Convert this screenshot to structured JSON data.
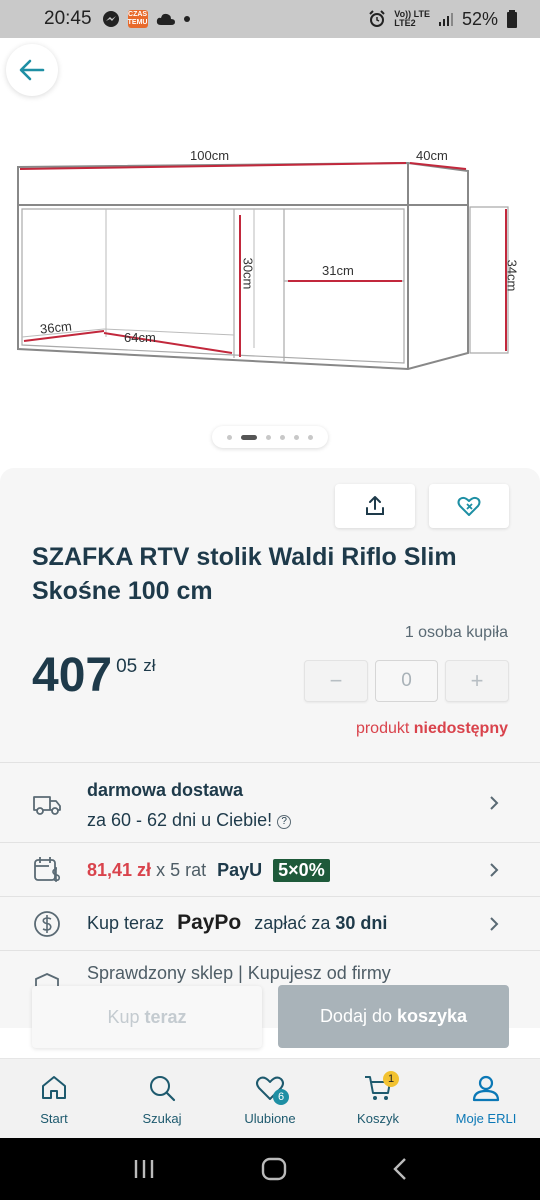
{
  "status_bar": {
    "time": "20:45",
    "temu_badge": "CZAS NA TEMU",
    "lte_top": "Vo)) LTE",
    "lte_bottom": "LTE2",
    "battery": "52%"
  },
  "gallery": {
    "images_count": 7,
    "active_index": 1,
    "dimensions": {
      "width": "100cm",
      "depth": "40cm",
      "height_right": "34cm",
      "inner_height": "30cm",
      "shelf_width": "31cm",
      "inner_depth": "36cm",
      "inner_width": "64cm"
    }
  },
  "product": {
    "title": "SZAFKA RTV stolik Waldi Riflo Slim Skośne 100 cm",
    "buyers": "1 osoba kupiła",
    "price_int": "407",
    "price_dec": "05",
    "currency": "zł",
    "quantity": "0",
    "minus": "−",
    "plus": "+",
    "availability_prefix": "produkt",
    "availability_status": "niedostępny"
  },
  "info_rows": {
    "delivery_title": "darmowa dostawa",
    "delivery_time": "za 60 - 62 dni u Ciebie!",
    "installment_amount": "81,41 zł",
    "installment_text": "x 5 rat",
    "payu_label": "PayU",
    "payu_badge": "5×0%",
    "paypo_prefix": "Kup teraz",
    "paypo_label": "PayPo",
    "paypo_suffix": "zapłać za",
    "paypo_days": "30 dni",
    "verified_text": "Sprawdzony sklep | Kupujesz od firmy"
  },
  "cta": {
    "buy_now_light": "Kup",
    "buy_now_bold": "teraz",
    "add_light": "Dodaj do",
    "add_bold": "koszyka"
  },
  "tabs": [
    {
      "label": "Start",
      "icon": "home-icon"
    },
    {
      "label": "Szukaj",
      "icon": "search-icon"
    },
    {
      "label": "Ulubione",
      "icon": "heart-icon",
      "badge": "6"
    },
    {
      "label": "Koszyk",
      "icon": "cart-icon",
      "badge": "1"
    },
    {
      "label": "Moje ERLI",
      "icon": "user-icon",
      "active": true
    }
  ],
  "colors": {
    "primary": "#1e3a4a",
    "green": "#2e9e4f",
    "red": "#d9434c",
    "disabled_button": "#a9b3b9",
    "active_tab": "#0b78b6"
  }
}
